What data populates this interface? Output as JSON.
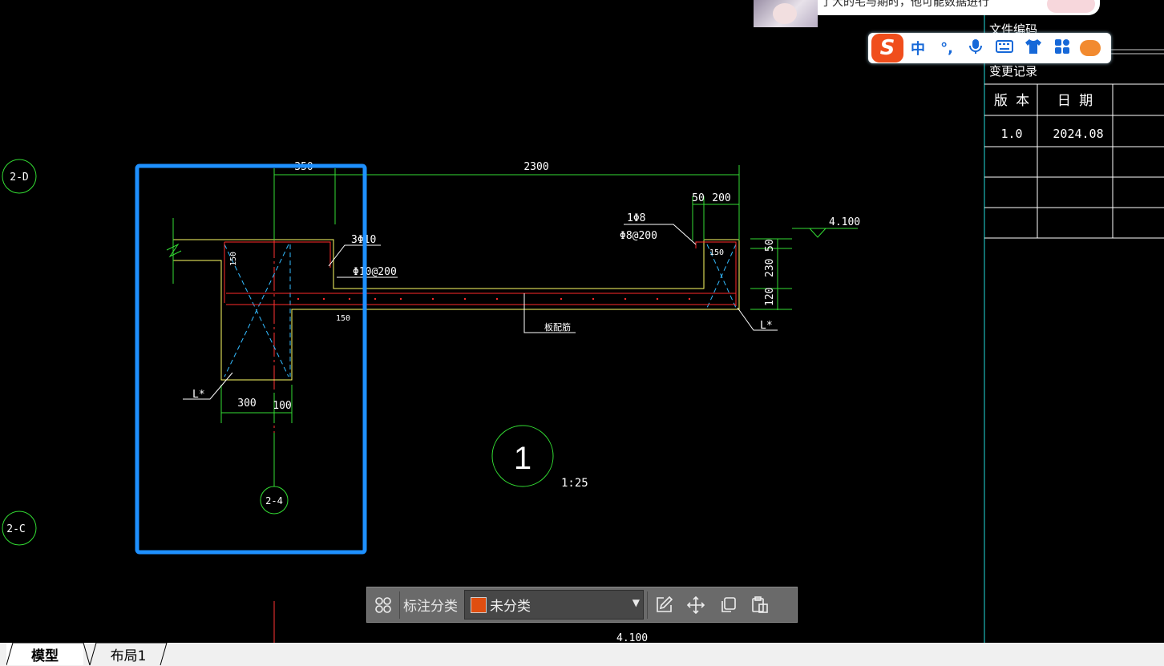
{
  "drawing": {
    "grid_bubbles": [
      "2-D",
      "2-C",
      "2-4"
    ],
    "section_number": "1",
    "scale": "1:25",
    "dims": {
      "d350": "350",
      "d2300": "2300",
      "d50": "50",
      "d200": "200",
      "v50": "50",
      "v230": "230",
      "v120": "120",
      "d300": "300",
      "d100": "100",
      "d150a": "150",
      "d150b": "150",
      "d150c": "150"
    },
    "labels": {
      "bars_top": "3Φ10",
      "stirrup": "Φ10@200",
      "bar_1": "1Φ8",
      "stirrup_2": "Φ8@200",
      "slab_rebar": "板配筋",
      "level": "4.100",
      "level_bottom": "4.100",
      "beam_left": "L*",
      "beam_right": "L*"
    },
    "colors": {
      "frame": "#1e90ff",
      "outline": "#ffff66",
      "dim": "#33dd33",
      "rebar": "#ff2a2a",
      "hatch": "#33bbff"
    }
  },
  "title_block": {
    "file_code": "文件编码",
    "change_record": "变更记录",
    "headers": [
      "版 本",
      "日 期"
    ],
    "rows": [
      [
        "1.0",
        "2024.08"
      ],
      [
        "",
        ""
      ],
      [
        "",
        ""
      ],
      [
        "",
        ""
      ]
    ]
  },
  "notification": {
    "text": "了大的宅与期时，他可能数据进行"
  },
  "ime_toolbar": {
    "logo": "S",
    "items": [
      "中",
      "°,",
      "mic-icon",
      "keyboard-icon",
      "skin-icon",
      "apps-icon",
      "mascot-icon"
    ]
  },
  "annotation_toolbar": {
    "label": "标注分类",
    "category_value": "未分类",
    "category_color": "#e04e10",
    "buttons": [
      "edit-icon",
      "move-icon",
      "copy-icon",
      "paste-icon"
    ]
  },
  "tabs": {
    "model": "模型",
    "layout1": "布局1"
  }
}
